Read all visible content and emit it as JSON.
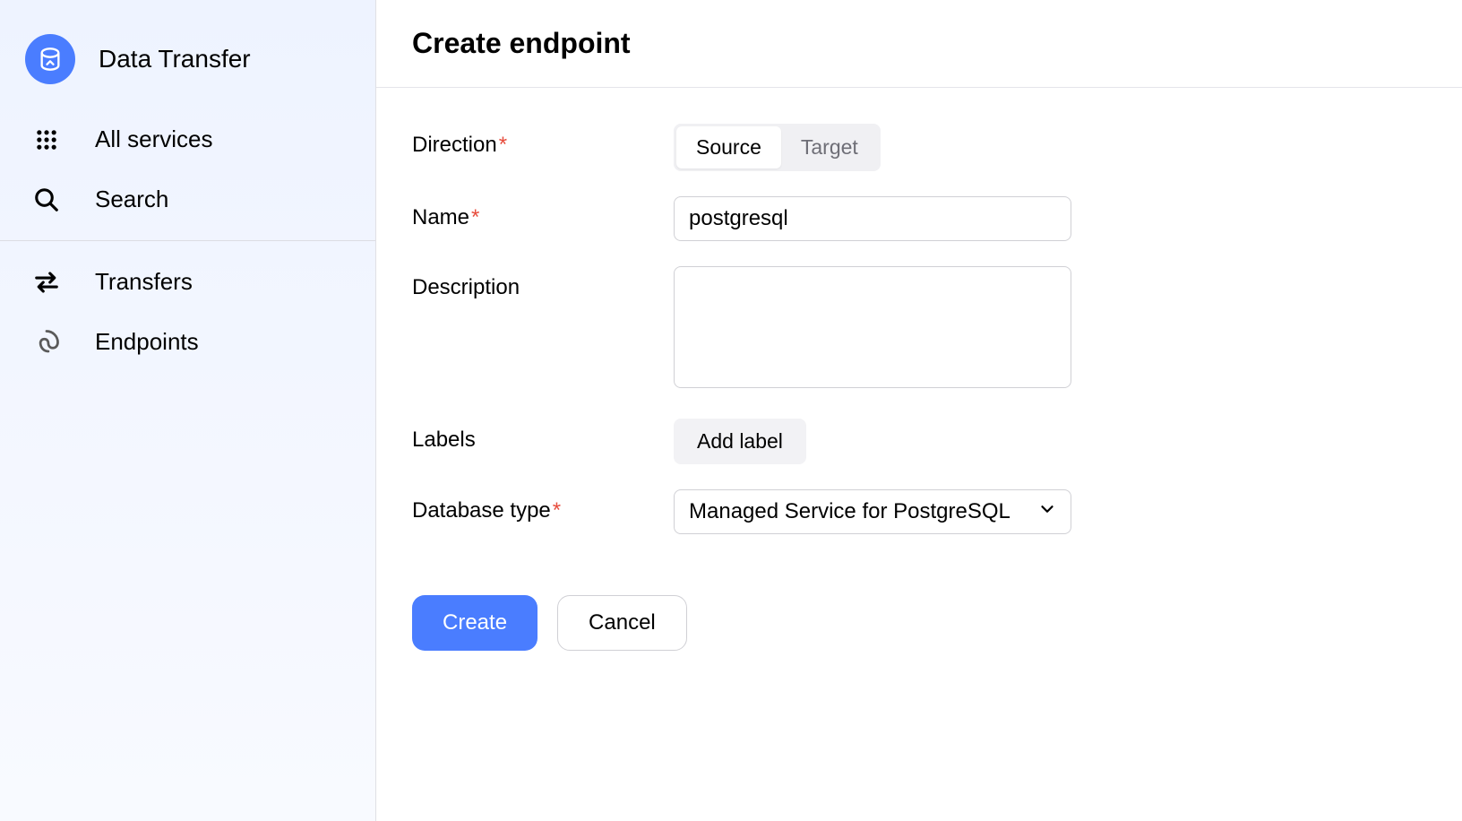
{
  "sidebar": {
    "brand": "Data Transfer",
    "items_top": [
      {
        "label": "All services",
        "icon": "grid"
      },
      {
        "label": "Search",
        "icon": "search"
      }
    ],
    "items_bottom": [
      {
        "label": "Transfers",
        "icon": "arrows"
      },
      {
        "label": "Endpoints",
        "icon": "swirl"
      }
    ]
  },
  "main": {
    "title": "Create endpoint",
    "labels": {
      "direction": "Direction",
      "name": "Name",
      "description": "Description",
      "labels_field": "Labels",
      "database_type": "Database type"
    },
    "direction": {
      "options": [
        "Source",
        "Target"
      ],
      "selected": "Source"
    },
    "name_value": "postgresql",
    "description_value": "",
    "add_label_btn": "Add label",
    "database_type_value": "Managed Service for PostgreSQL",
    "actions": {
      "create": "Create",
      "cancel": "Cancel"
    }
  }
}
